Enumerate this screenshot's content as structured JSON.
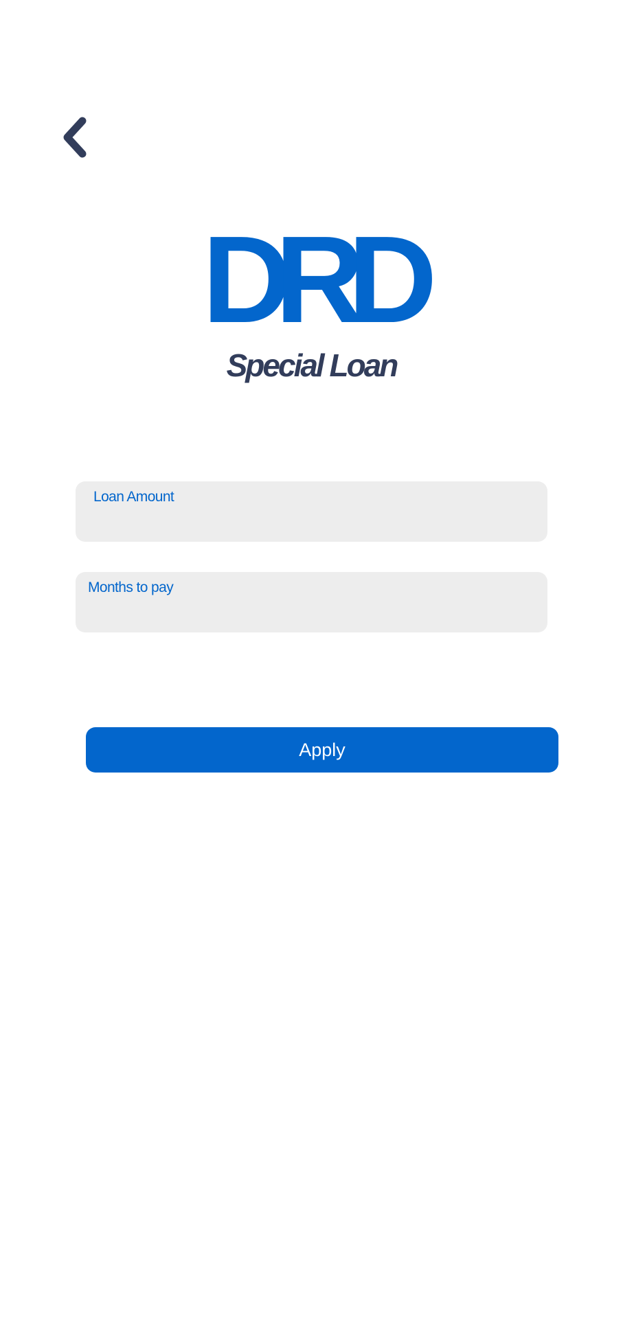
{
  "header": {
    "back_icon": "chevron-left-icon"
  },
  "brand": {
    "logo_text": "DRD",
    "subtitle": "Special Loan"
  },
  "form": {
    "loan_amount": {
      "label": "Loan Amount",
      "value": "",
      "placeholder": ""
    },
    "months_to_pay": {
      "label": "Months to pay",
      "value": "",
      "placeholder": ""
    },
    "apply_label": "Apply"
  },
  "colors": {
    "brand_blue": "#0366cc",
    "dark_navy": "#323d5b",
    "field_background": "#ededed",
    "background": "#ffffff"
  }
}
